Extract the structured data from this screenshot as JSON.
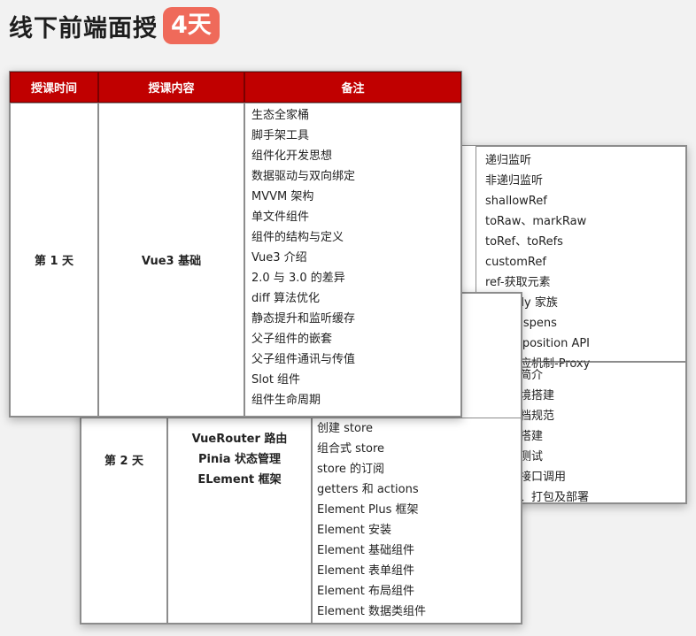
{
  "heading": {
    "title": "线下前端面授",
    "badge": "4天"
  },
  "table": {
    "headers": [
      "授课时间",
      "授课内容",
      "备注"
    ],
    "day1": {
      "day": "第 1 天",
      "content": "Vue3 基础",
      "notes": [
        "生态全家桶",
        "脚手架工具",
        "组件化开发思想",
        "数据驱动与双向绑定",
        "MVVM 架构",
        "单文件组件",
        "组件的结构与定义",
        "Vue3 介绍",
        "2.0 与 3.0 的差异",
        "diff 算法优化",
        "静态提升和监听缓存",
        "父子组件的嵌套",
        "父子组件通讯与传值",
        "Slot 组件",
        "组件生命周期"
      ]
    },
    "day2": {
      "day": "第 2 天",
      "content": [
        "VueRouter 路由",
        "Pinia 状态管理",
        "ELement 框架"
      ],
      "notes": [
        "创建 store",
        "组合式 store",
        "store 的订阅",
        "getters 和 actions",
        "Element Plus 框架",
        "Element 安装",
        "Element 基础组件",
        "Element 表单组件",
        "Element 布局组件",
        "Element 数据类组件"
      ]
    },
    "back": {
      "notes_top": [
        "递归监听",
        "非递归监听",
        "shallowRef",
        "toRaw、markRaw",
        "toRef、toRefs",
        "customRef",
        "ref-获取元素",
        "eadonly 家族",
        "t 和 Suspens",
        "e Composition API",
        "数据响应机制-Proxy"
      ],
      "notes_bottom": [
        "战案例简介",
        "式和环境搭建",
        "首及文档规范",
        "目页面搭建",
        "目接口测试",
        "目前端接口调用",
        "目联调、打包及部署"
      ]
    }
  }
}
